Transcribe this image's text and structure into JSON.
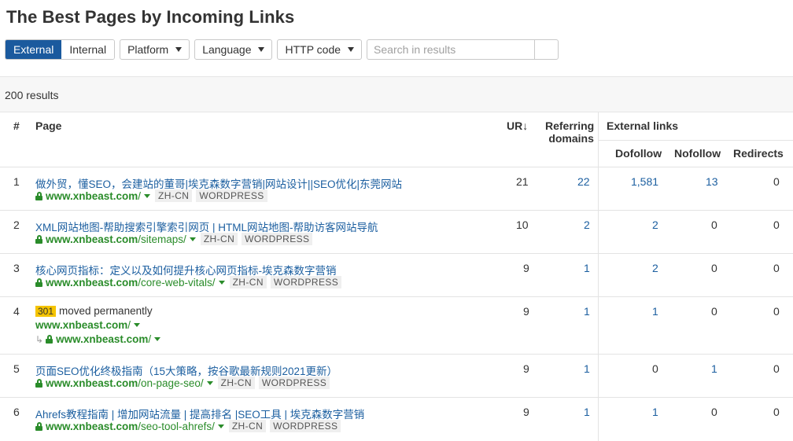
{
  "page_title": "The Best Pages by Incoming Links",
  "filters": {
    "segment": [
      "External",
      "Internal"
    ],
    "active_segment": "External",
    "dropdowns": [
      "Platform",
      "Language",
      "HTTP code"
    ],
    "search_placeholder": "Search in results"
  },
  "results_count": "200 results",
  "columns": {
    "index": "#",
    "page": "Page",
    "ur": "UR",
    "ur_sort": "↓",
    "referring_domains_line1": "Referring",
    "referring_domains_line2": "domains",
    "external_links": "External links",
    "dofollow": "Dofollow",
    "nofollow": "Nofollow",
    "redirects": "Redirects"
  },
  "colors": {
    "active_tab": "#1b5a9e",
    "link": "#1c5fa0",
    "url_green": "#2a8c2a",
    "badge_301": "#f5c400"
  },
  "rows": [
    {
      "n": "1",
      "title": "做外贸，懂SEO，会建站的董哥|埃克森数字营销|网站设计||SEO优化|东莞网站",
      "domain": "www.xnbeast.com",
      "path": "/",
      "tags": [
        "ZH-CN",
        "WORDPRESS"
      ],
      "ur": "21",
      "rd": "22",
      "dofollow": "1,581",
      "nofollow": "13",
      "redirects": "0"
    },
    {
      "n": "2",
      "title": "XML网站地图-帮助搜索引擎索引网页 | HTML网站地图-帮助访客网站导航",
      "domain": "www.xnbeast.com",
      "path": "/sitemaps/",
      "tags": [
        "ZH-CN",
        "WORDPRESS"
      ],
      "ur": "10",
      "rd": "2",
      "dofollow": "2",
      "nofollow": "0",
      "redirects": "0"
    },
    {
      "n": "3",
      "title": "核心网页指标：定义以及如何提升核心网页指标-埃克森数字营销",
      "domain": "www.xnbeast.com",
      "path": "/core-web-vitals/",
      "tags": [
        "ZH-CN",
        "WORDPRESS"
      ],
      "ur": "9",
      "rd": "1",
      "dofollow": "2",
      "nofollow": "0",
      "redirects": "0"
    },
    {
      "n": "4",
      "badge": "301",
      "title": "moved permanently",
      "domain": "www.xnbeast.com",
      "path": "/",
      "redirect_domain": "www.xnbeast.com",
      "redirect_path": "/",
      "ur": "9",
      "rd": "1",
      "dofollow": "1",
      "nofollow": "0",
      "redirects": "0"
    },
    {
      "n": "5",
      "title": "页面SEO优化终极指南（15大策略，按谷歌最新规则2021更新）",
      "domain": "www.xnbeast.com",
      "path": "/on-page-seo/",
      "tags": [
        "ZH-CN",
        "WORDPRESS"
      ],
      "ur": "9",
      "rd": "1",
      "dofollow": "0",
      "nofollow": "1",
      "redirects": "0"
    },
    {
      "n": "6",
      "title": "Ahrefs教程指南 | 增加网站流量 | 提高排名 |SEO工具 | 埃克森数字营销",
      "domain": "www.xnbeast.com",
      "path": "/seo-tool-ahrefs/",
      "tags": [
        "ZH-CN",
        "WORDPRESS"
      ],
      "ur": "9",
      "rd": "1",
      "dofollow": "1",
      "nofollow": "0",
      "redirects": "0"
    }
  ]
}
